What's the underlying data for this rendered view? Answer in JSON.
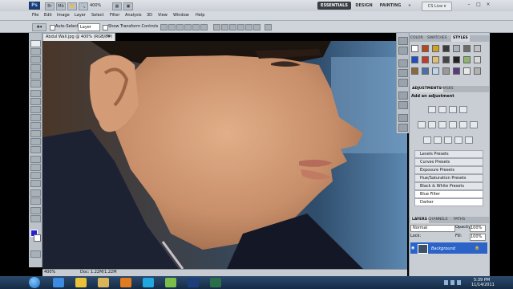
{
  "app": {
    "logo": "Ps",
    "zoom": "400%",
    "workspaces": [
      "ESSENTIALS",
      "DESIGN",
      "PAINTING"
    ],
    "workspaces_more": "»",
    "cs_live": "CS Live ▾",
    "window_controls": [
      "–",
      "□",
      "×"
    ]
  },
  "menu": [
    "File",
    "Edit",
    "Image",
    "Layer",
    "Select",
    "Filter",
    "Analysis",
    "3D",
    "View",
    "Window",
    "Help"
  ],
  "options": {
    "auto_select_label": "Auto-Select:",
    "layer_value": "Layer",
    "transform_label": "Show Transform Controls"
  },
  "document": {
    "tab_title": "Abdul Wali.jpg @ 400% (RGB/8#)",
    "close": "×",
    "zoom": "400%",
    "doc_info": "Doc: 1.22M/1.22M"
  },
  "colors": {
    "foreground": "#2b1fd6",
    "background": "#ffffff"
  },
  "panels": {
    "top_tabs": [
      "COLOR",
      "SWATCHES",
      "STYLES"
    ],
    "adjust_tabs": [
      "ADJUSTMENTS",
      "MASKS"
    ],
    "add_adjustment": "Add an adjustment",
    "presets": [
      "Levels Presets",
      "Curves Presets",
      "Exposure Presets",
      "Hue/Saturation Presets",
      "Black & White Presets",
      "Blue Filter",
      "Darker"
    ],
    "layers_tabs": [
      "LAYERS",
      "CHANNELS",
      "PATHS"
    ],
    "blend_mode": "Normal",
    "opacity_label": "Opacity:",
    "opacity_value": "100%",
    "lock_label": "Lock:",
    "fill_label": "Fill:",
    "fill_value": "100%",
    "layer_name": "Background"
  },
  "taskbar": {
    "time": "5:39 PM",
    "date": "11/14/2011"
  }
}
